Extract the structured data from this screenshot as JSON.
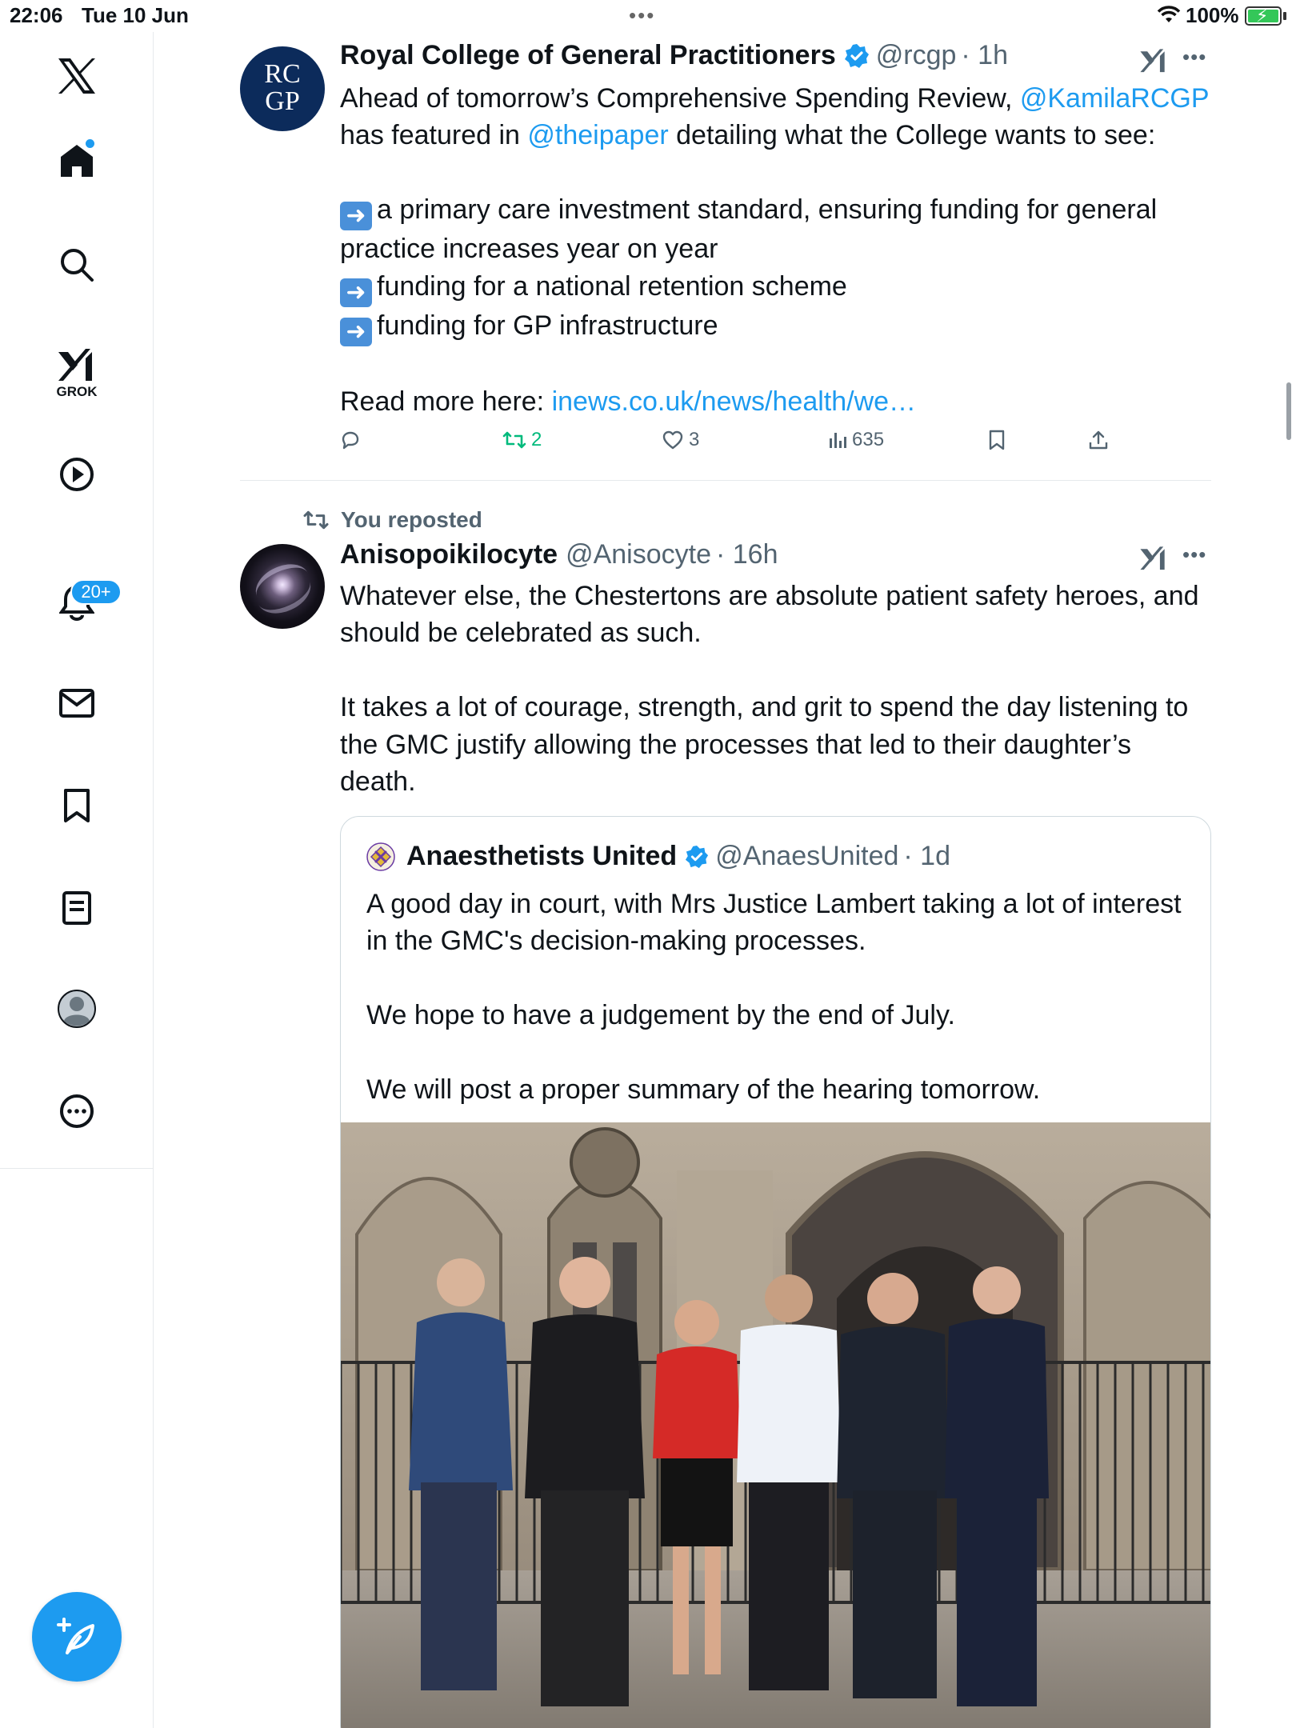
{
  "status_bar": {
    "time": "22:06",
    "date": "Tue 10 Jun",
    "battery": "100%"
  },
  "sidebar": {
    "items": [
      {
        "name": "home",
        "label": "Home"
      },
      {
        "name": "explore",
        "label": "Explore"
      },
      {
        "name": "grok",
        "label": "GROK"
      },
      {
        "name": "video",
        "label": "Video"
      },
      {
        "name": "notifications",
        "label": "Notifications",
        "badge": "20+"
      },
      {
        "name": "messages",
        "label": "Messages"
      },
      {
        "name": "bookmarks",
        "label": "Bookmarks"
      },
      {
        "name": "lists",
        "label": "Lists"
      },
      {
        "name": "profile",
        "label": "Profile"
      },
      {
        "name": "more",
        "label": "More"
      }
    ],
    "grok_label": "GROK",
    "notifications_badge": "20+"
  },
  "tweets": [
    {
      "author": "Royal College of General Practitioners",
      "handle": "@rcgp",
      "time": "· 1h",
      "avatar": {
        "line1": "RC",
        "line2": "GP"
      },
      "text": {
        "l1_pre": "Ahead of tomorrow’s Comprehensive Spending Review, ",
        "l1_link": "@KamilaRCGP",
        "l2_pre": "has featured in ",
        "l2_link": "@theipaper",
        "l2_post": " detailing what the College wants to see:",
        "b1a": "a primary care investment standard, ensuring funding for general",
        "b1b": "practice increases year on year",
        "b2": "funding for a national retention scheme",
        "b3": "funding for GP infrastructure",
        "read_more": "Read more here: ",
        "read_more_link": "inews.co.uk/news/health/we…"
      },
      "actions": {
        "replies": "",
        "reposts": "2",
        "likes": "3",
        "views": "635"
      }
    },
    {
      "repost_label": "You reposted",
      "author": "Anisopoikilocyte",
      "handle": "@Anisocyte",
      "time": "· 16h",
      "text": {
        "l1": "Whatever else, the Chestertons are absolute patient safety heroes, and",
        "l2": "should be celebrated as such.",
        "l3": "It takes a lot of courage, strength, and grit to spend the day listening to",
        "l4": "the GMC justify allowing the processes that led to their daughter’s",
        "l5": "death."
      },
      "quote": {
        "author": "Anaesthetists United",
        "handle": "@AnaesUnited",
        "time": "· 1d",
        "l1": "A good day in court, with Mrs Justice Lambert taking a lot of interest",
        "l2": "in the GMC's decision-making processes.",
        "l3": "We hope to have a judgement by the end of July.",
        "l4": "We will post a proper summary of the hearing tomorrow."
      }
    }
  ],
  "colors": {
    "accent": "#1d9bf0",
    "text": "#0f1419",
    "secondary": "#536471",
    "retweet": "#00ba7c",
    "rcgp_navy": "#0c2b5b"
  },
  "icons": [
    "x-logo-icon",
    "home-icon",
    "search-icon",
    "grok-icon",
    "video-icon",
    "bell-icon",
    "mail-icon",
    "bookmark-icon",
    "list-icon",
    "profile-icon",
    "more-circle-icon",
    "compose-icon",
    "reply-icon",
    "retweet-icon",
    "heart-icon",
    "views-icon",
    "share-icon",
    "verified-icon"
  ]
}
